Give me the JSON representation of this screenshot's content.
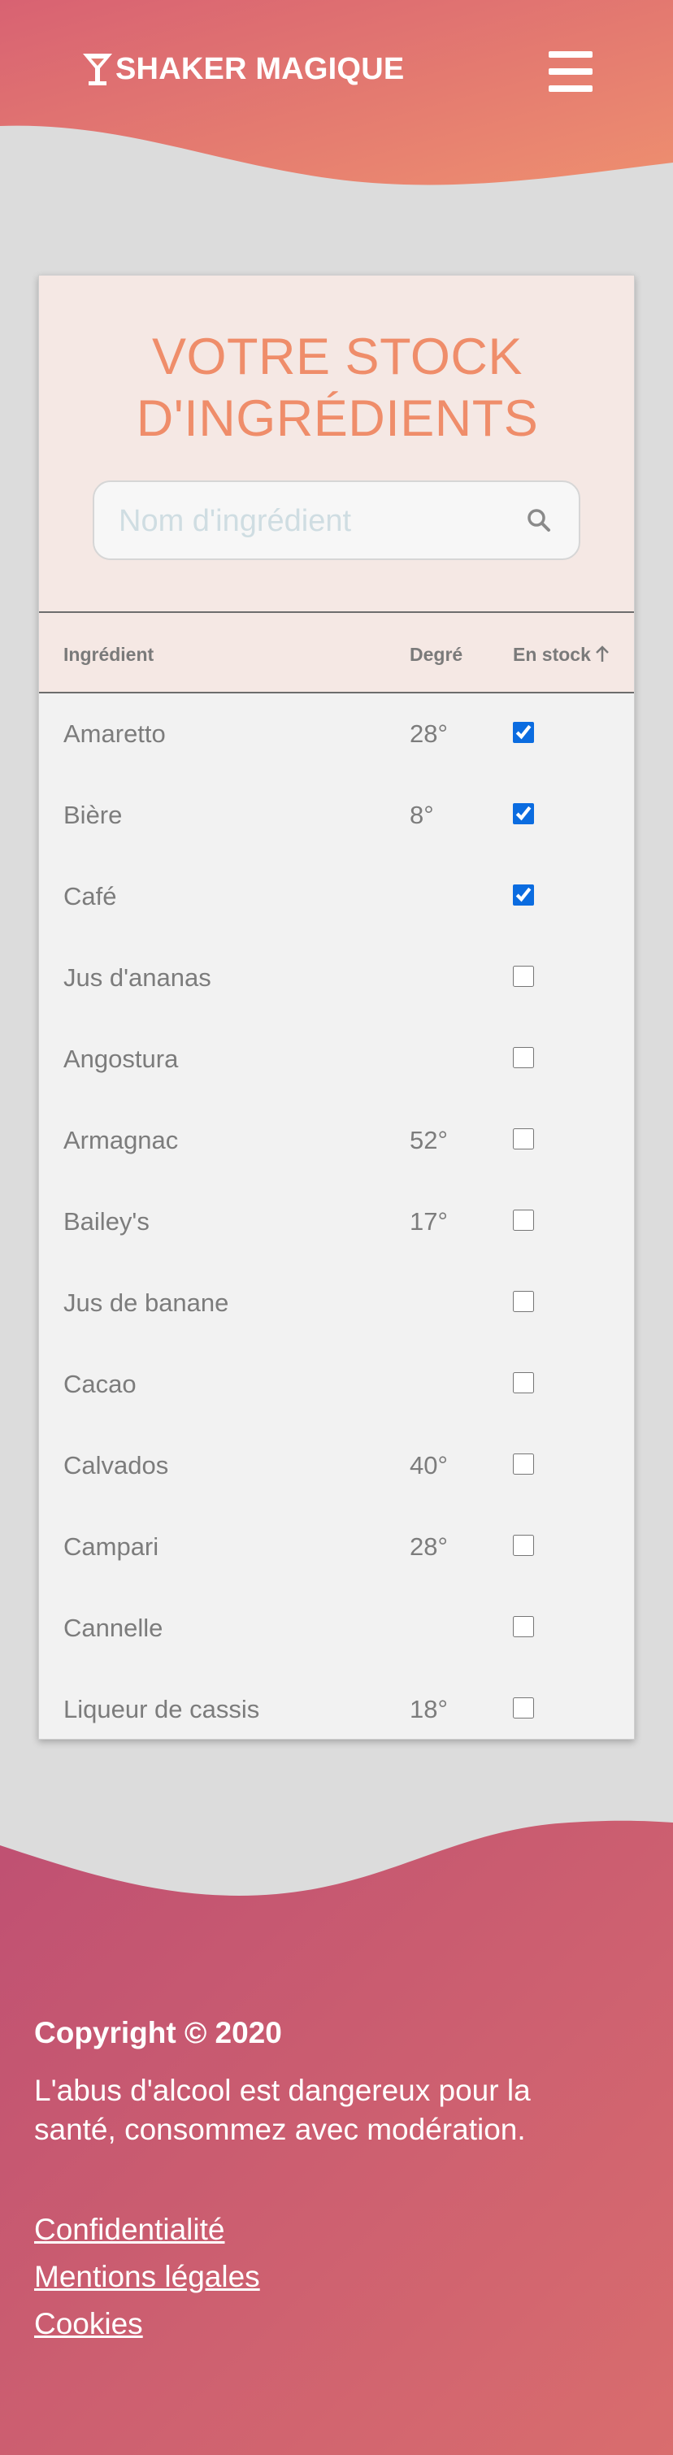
{
  "header": {
    "brand": "SHAKER MAGIQUE",
    "gradient": [
      "#d86272",
      "#ee8f6f"
    ]
  },
  "card": {
    "title": "VOTRE STOCK D'INGRÉDIENTS",
    "accent": "#ef8d6a",
    "search": {
      "placeholder": "Nom d'ingrédient",
      "value": ""
    },
    "columns": {
      "name": "Ingrédient",
      "degree": "Degré",
      "stock": "En stock",
      "sort": "ascending"
    },
    "rows": [
      {
        "name": "Amaretto",
        "degree": "28°",
        "in_stock": true
      },
      {
        "name": "Bière",
        "degree": "8°",
        "in_stock": true
      },
      {
        "name": "Café",
        "degree": "",
        "in_stock": true
      },
      {
        "name": "Jus d'ananas",
        "degree": "",
        "in_stock": false
      },
      {
        "name": "Angostura",
        "degree": "",
        "in_stock": false
      },
      {
        "name": "Armagnac",
        "degree": "52°",
        "in_stock": false
      },
      {
        "name": "Bailey's",
        "degree": "17°",
        "in_stock": false
      },
      {
        "name": "Jus de banane",
        "degree": "",
        "in_stock": false
      },
      {
        "name": "Cacao",
        "degree": "",
        "in_stock": false
      },
      {
        "name": "Calvados",
        "degree": "40°",
        "in_stock": false
      },
      {
        "name": "Campari",
        "degree": "28°",
        "in_stock": false
      },
      {
        "name": "Cannelle",
        "degree": "",
        "in_stock": false
      },
      {
        "name": "Liqueur de cassis",
        "degree": "18°",
        "in_stock": false
      }
    ]
  },
  "footer": {
    "copyright": "Copyright © 2020",
    "warning": "L'abus d'alcool est dangereux pour la santé, consommez avec modération.",
    "links": [
      "Confidentialité",
      "Mentions légales",
      "Cookies"
    ],
    "gradient": [
      "#bf5072",
      "#d96d6e"
    ]
  }
}
